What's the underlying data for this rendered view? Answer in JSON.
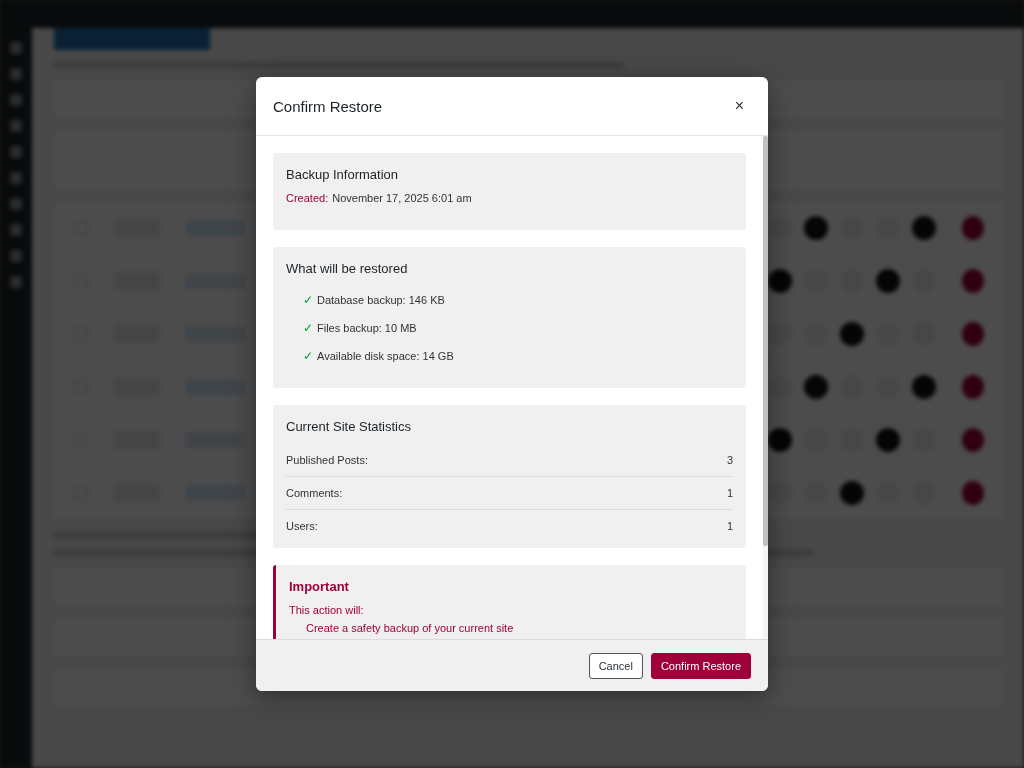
{
  "modal": {
    "title": "Confirm Restore",
    "close": "×",
    "sections": [
      {
        "kind": "info",
        "title": "Backup Information",
        "fields": [
          {
            "label": "Created:",
            "value": "November 17, 2025 6:01 am"
          }
        ]
      },
      {
        "kind": "checklist",
        "title": "What will be restored",
        "check": "✓",
        "items": [
          "Database backup: 146 KB",
          "Files backup: 10 MB",
          "Available disk space: 14 GB"
        ]
      },
      {
        "kind": "stats",
        "title": "Current Site Statistics",
        "rows": [
          {
            "label": "Published Posts:",
            "value": "3"
          },
          {
            "label": "Comments:",
            "value": "1"
          },
          {
            "label": "Users:",
            "value": "1"
          }
        ]
      },
      {
        "kind": "warning",
        "title": "Important",
        "subtitle": "This action will:",
        "items": [
          "Create a safety backup of your current site"
        ]
      }
    ],
    "buttons": [
      {
        "label": "Cancel",
        "kind": "secondary"
      },
      {
        "label": "Confirm Restore",
        "kind": "primary"
      }
    ]
  }
}
